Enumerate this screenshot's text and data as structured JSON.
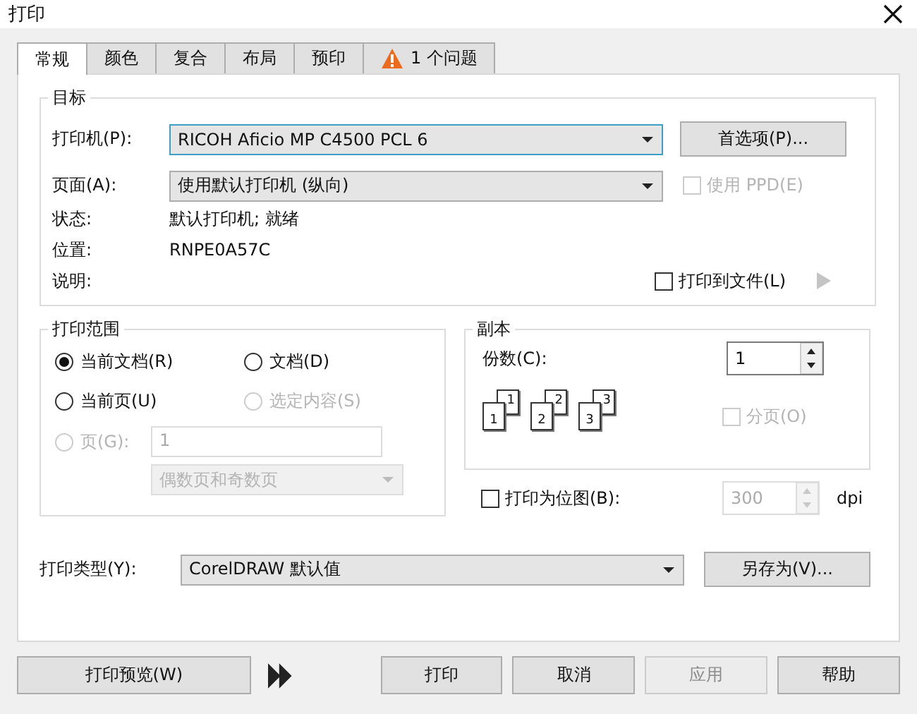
{
  "window": {
    "title": "打印"
  },
  "tabs": [
    {
      "label": "常规",
      "selected": true,
      "kind": "plain"
    },
    {
      "label": "颜色",
      "selected": false,
      "kind": "plain"
    },
    {
      "label": "复合",
      "selected": false,
      "kind": "plain"
    },
    {
      "label": "布局",
      "selected": false,
      "kind": "plain"
    },
    {
      "label": "预印",
      "selected": false,
      "kind": "plain"
    },
    {
      "label": "1 个问题",
      "selected": false,
      "kind": "warning"
    }
  ],
  "destination": {
    "title": "目标",
    "printer": {
      "label": "打印机(P):",
      "value": "RICOH Aficio MP C4500 PCL 6"
    },
    "preferences_button": "首选项(P)...",
    "page": {
      "label": "页面(A):",
      "value": "使用默认打印机 (纵向)"
    },
    "use_ppd": {
      "label": "使用 PPD(E)",
      "checked": false,
      "disabled": true
    },
    "status": {
      "label": "状态:",
      "value": "默认打印机; 就绪"
    },
    "location": {
      "label": "位置:",
      "value": "RNPE0A57C"
    },
    "description": {
      "label": "说明:"
    },
    "print_to_file": {
      "label": "打印到文件(L)",
      "checked": false
    }
  },
  "range": {
    "title": "打印范围",
    "options": [
      {
        "label": "当前文档(R)",
        "selected": true,
        "disabled": false
      },
      {
        "label": "文档(D)",
        "selected": false,
        "disabled": false
      },
      {
        "label": "当前页(U)",
        "selected": false,
        "disabled": false
      },
      {
        "label": "选定内容(S)",
        "selected": false,
        "disabled": true
      },
      {
        "label": "页(G):",
        "selected": false,
        "disabled": true
      }
    ],
    "pages_value": "1",
    "page_set": "偶数页和奇数页",
    "fields_disabled": true
  },
  "copies": {
    "title": "副本",
    "count_label": "份数(C):",
    "count": "1",
    "pages": [
      {
        "back": "1",
        "front": "1"
      },
      {
        "back": "2",
        "front": "2"
      },
      {
        "back": "3",
        "front": "3"
      }
    ],
    "collate": {
      "label": "分页(O)",
      "checked": false,
      "disabled": true
    }
  },
  "bitmap": {
    "label": "打印为位图(B):",
    "checked": false,
    "dpi": "300",
    "dpi_disabled": true,
    "unit": "dpi"
  },
  "print_type": {
    "label": "打印类型(Y):",
    "value": "CorelDRAW 默认值",
    "save_button": "另存为(V)..."
  },
  "buttons": [
    {
      "label": "打印预览(W)",
      "kind": "preview",
      "disabled": false
    },
    {
      "label": "打印",
      "kind": "action",
      "disabled": false
    },
    {
      "label": "取消",
      "kind": "action",
      "disabled": false
    },
    {
      "label": "应用",
      "kind": "action",
      "disabled": true
    },
    {
      "label": "帮助",
      "kind": "action",
      "disabled": false
    }
  ]
}
